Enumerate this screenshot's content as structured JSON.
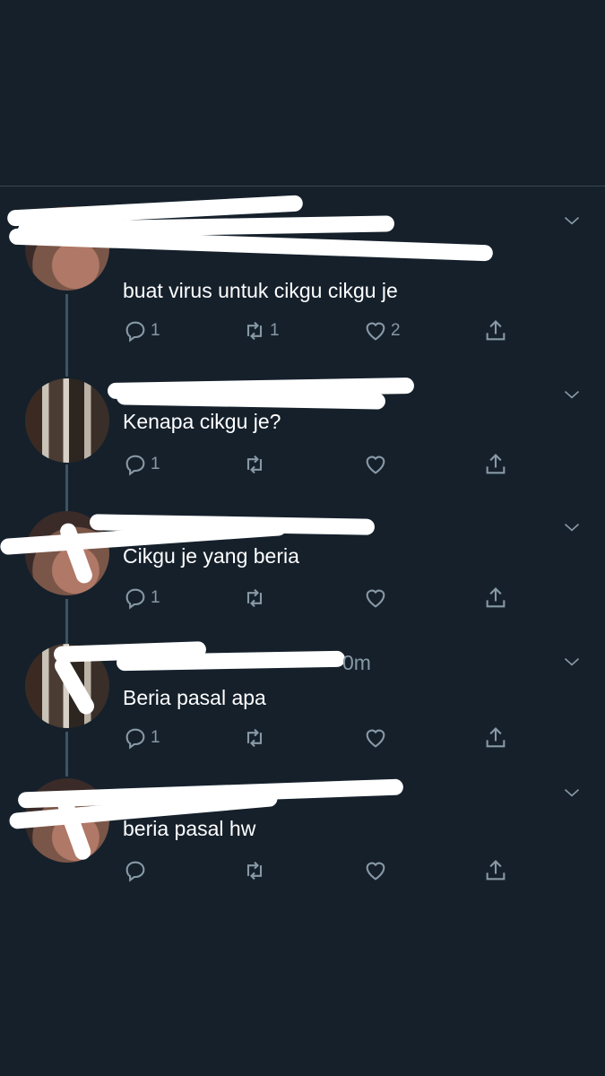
{
  "tweets": [
    {
      "text": "buat virus untuk cikgu cikgu je",
      "reply_count": "1",
      "retweet_count": "1",
      "like_count": "2"
    },
    {
      "text": "Kenapa cikgu je?",
      "reply_count": "1",
      "retweet_count": "",
      "like_count": ""
    },
    {
      "text": "Cikgu je yang beria",
      "reply_count": "1",
      "retweet_count": "",
      "like_count": ""
    },
    {
      "text": "Beria pasal apa",
      "reply_count": "1",
      "retweet_count": "",
      "like_count": "",
      "time_fragment": "0m"
    },
    {
      "text": "beria pasal hw",
      "reply_count": "",
      "retweet_count": "",
      "like_count": ""
    }
  ],
  "icons": {
    "reply": "reply-icon",
    "retweet": "retweet-icon",
    "like": "heart-icon",
    "share": "share-icon",
    "menu": "chevron-down-icon"
  },
  "colors": {
    "background": "#15202b",
    "muted": "#8899a6",
    "text": "#ffffff"
  }
}
